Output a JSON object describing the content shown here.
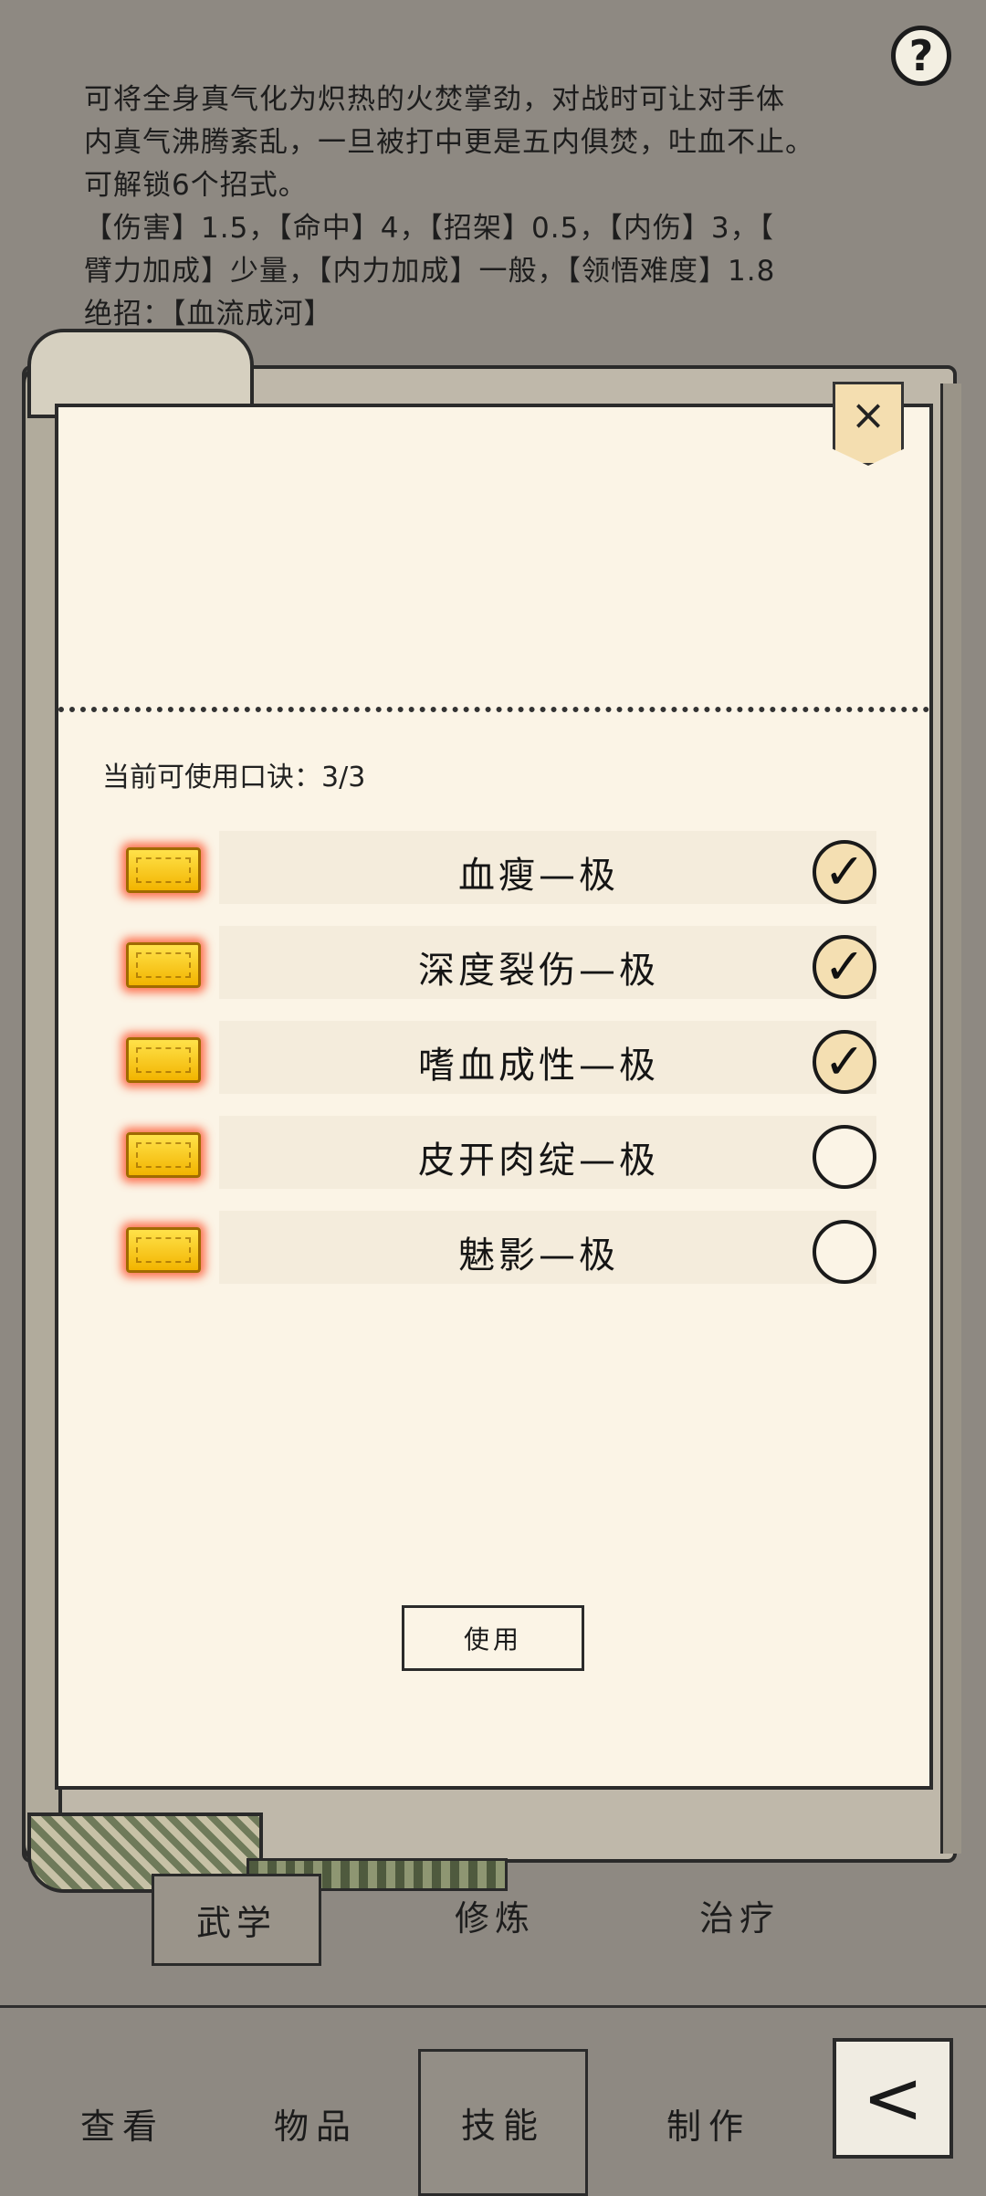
{
  "description": {
    "lines": [
      "可将全身真气化为炽热的火焚掌劲，对战时可让对手体",
      "内真气沸腾紊乱，一旦被打中更是五内俱焚，吐血不止。",
      "可解锁6个招式。",
      "【伤害】1.5，【命中】4，【招架】0.5，【内伤】3，【",
      "臂力加成】少量，【内力加成】一般，【领悟难度】1.8",
      "绝招：【血流成河】"
    ]
  },
  "help_label": "?",
  "close_label": "×",
  "panel": {
    "count_text": "当前可使用口诀：3/3",
    "items": [
      {
        "label": "血瘦—极",
        "checked": true,
        "mark": "✓"
      },
      {
        "label": "深度裂伤—极",
        "checked": true,
        "mark": "✓"
      },
      {
        "label": "嗜血成性—极",
        "checked": true,
        "mark": "✓"
      },
      {
        "label": "皮开肉绽—极",
        "checked": false,
        "mark": ""
      },
      {
        "label": "魅影—极",
        "checked": false,
        "mark": ""
      }
    ],
    "use_button": "使用"
  },
  "subtabs": [
    "武学",
    "修炼",
    "治疗"
  ],
  "nav": {
    "items": [
      "查看",
      "物品",
      "技能",
      "制作"
    ],
    "back_icon": "<"
  },
  "colors": {
    "background": "#8e8982",
    "paper": "#fbf4e6",
    "gold": "#f2b400",
    "glow": "#ff4620"
  }
}
